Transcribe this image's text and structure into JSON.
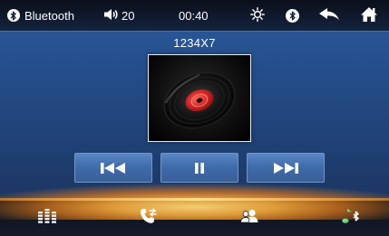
{
  "status_bar": {
    "source_label": "Bluetooth",
    "volume": "20",
    "clock": "00:40",
    "icons": [
      "bluetooth-icon",
      "speaker-icon",
      "brightness-icon",
      "bluetooth-icon",
      "back-arrow-icon",
      "home-icon"
    ]
  },
  "player": {
    "track_title": "1234X7",
    "album_art": "vinyl-record-icon",
    "controls": [
      "previous-icon",
      "pause-icon",
      "next-icon"
    ]
  },
  "dock": {
    "items": [
      "equalizer-icon",
      "phone-transfer-icon",
      "contacts-icon",
      "bluetooth-music-icon"
    ]
  },
  "colors": {
    "accent": "#3f6aa8",
    "glow": "#f5aa3c",
    "record_label": "#c8282a"
  }
}
